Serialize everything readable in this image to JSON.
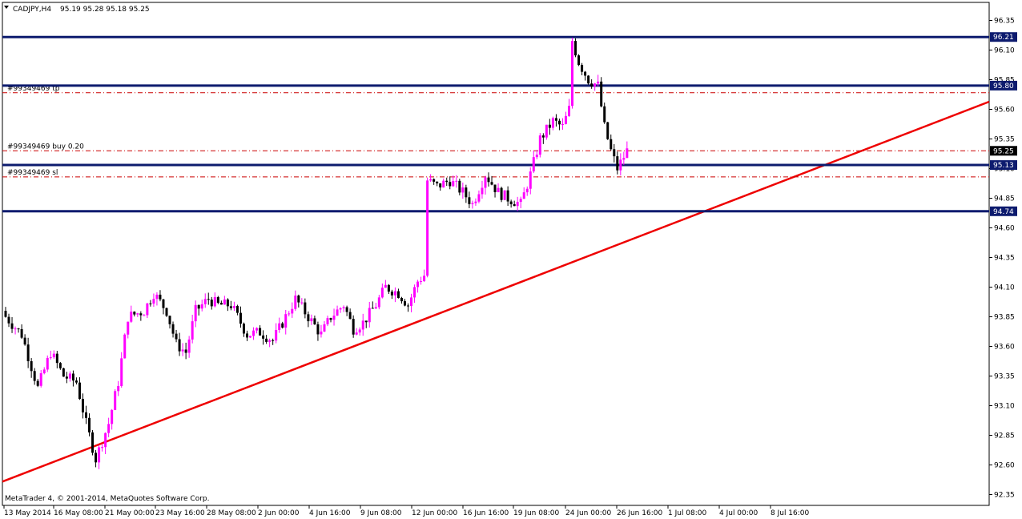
{
  "header": {
    "symbol_timeframe": "CADJPY,H4",
    "ohlc": "95.19 95.28 95.18 95.25"
  },
  "copyright": "MetaTrader 4, © 2001-2014, MetaQuotes Software Corp.",
  "colors": {
    "background": "#ffffff",
    "frame": "#000000",
    "bull_candle": "#ff00ff",
    "bear_candle": "#000000",
    "horizontal_level": "#0d1b6e",
    "trendline": "#ee0000",
    "order_line": "#cc0000"
  },
  "icons": {
    "menu_arrow": "triangle-down-icon"
  },
  "chart_data": {
    "type": "candlestick",
    "instrument": "CADJPY",
    "timeframe": "H4",
    "y_range": [
      92.3,
      96.45
    ],
    "y_ticks": [
      "96.35",
      "96.10",
      "95.85",
      "95.60",
      "95.35",
      "95.10",
      "94.85",
      "94.60",
      "94.35",
      "94.10",
      "93.85",
      "93.60",
      "93.35",
      "93.10",
      "92.85",
      "92.60",
      "92.35"
    ],
    "x_ticks": [
      "13 May 2014",
      "16 May 08:00",
      "21 May 00:00",
      "23 May 16:00",
      "28 May 08:00",
      "2 Jun 00:00",
      "4 Jun 16:00",
      "9 Jun 08:00",
      "12 Jun 00:00",
      "16 Jun 16:00",
      "19 Jun 08:00",
      "24 Jun 00:00",
      "26 Jun 16:00",
      "1 Jul 08:00",
      "4 Jul 00:00",
      "8 Jul 16:00"
    ],
    "candle_count": 242,
    "horizontal_levels": [
      {
        "price": 96.21,
        "label": "96.21"
      },
      {
        "price": 95.8,
        "label": "95.80"
      },
      {
        "price": 95.13,
        "label": "95.13"
      },
      {
        "price": 94.74,
        "label": "94.74"
      }
    ],
    "order_lines": [
      {
        "price": 95.74,
        "label": "#99349469 tp"
      },
      {
        "price": 95.25,
        "label": "#99349469 buy 0.20"
      },
      {
        "price": 95.03,
        "label": "#99349469 sl"
      }
    ],
    "current_price": {
      "price": 95.25,
      "label": "95.25"
    },
    "trendline": {
      "start": {
        "bar": 0,
        "price": 92.47
      },
      "end": {
        "bar": 241,
        "price": 94.99
      }
    },
    "anchors": [
      {
        "bar": 0,
        "price": 93.85
      },
      {
        "bar": 5,
        "price": 93.7
      },
      {
        "bar": 10,
        "price": 93.25
      },
      {
        "bar": 14,
        "price": 93.55
      },
      {
        "bar": 18,
        "price": 93.35
      },
      {
        "bar": 22,
        "price": 93.3
      },
      {
        "bar": 25,
        "price": 92.95
      },
      {
        "bar": 28,
        "price": 92.65
      },
      {
        "bar": 32,
        "price": 92.95
      },
      {
        "bar": 35,
        "price": 93.3
      },
      {
        "bar": 38,
        "price": 93.85
      },
      {
        "bar": 43,
        "price": 93.9
      },
      {
        "bar": 46,
        "price": 94.05
      },
      {
        "bar": 50,
        "price": 93.9
      },
      {
        "bar": 53,
        "price": 93.62
      },
      {
        "bar": 56,
        "price": 93.55
      },
      {
        "bar": 59,
        "price": 93.9
      },
      {
        "bar": 63,
        "price": 94.0
      },
      {
        "bar": 66,
        "price": 93.95
      },
      {
        "bar": 70,
        "price": 93.95
      },
      {
        "bar": 75,
        "price": 93.7
      },
      {
        "bar": 79,
        "price": 93.72
      },
      {
        "bar": 83,
        "price": 93.65
      },
      {
        "bar": 86,
        "price": 93.8
      },
      {
        "bar": 90,
        "price": 94.0
      },
      {
        "bar": 94,
        "price": 93.85
      },
      {
        "bar": 98,
        "price": 93.7
      },
      {
        "bar": 101,
        "price": 93.85
      },
      {
        "bar": 105,
        "price": 93.95
      },
      {
        "bar": 108,
        "price": 93.75
      },
      {
        "bar": 111,
        "price": 93.8
      },
      {
        "bar": 115,
        "price": 93.95
      },
      {
        "bar": 118,
        "price": 94.1
      },
      {
        "bar": 122,
        "price": 94.05
      },
      {
        "bar": 125,
        "price": 93.95
      },
      {
        "bar": 128,
        "price": 94.15
      },
      {
        "bar": 130,
        "price": 94.2
      },
      {
        "bar": 131,
        "price": 95.0
      },
      {
        "bar": 134,
        "price": 94.95
      },
      {
        "bar": 138,
        "price": 95.0
      },
      {
        "bar": 142,
        "price": 94.9
      },
      {
        "bar": 145,
        "price": 94.8
      },
      {
        "bar": 149,
        "price": 95.05
      },
      {
        "bar": 153,
        "price": 94.9
      },
      {
        "bar": 156,
        "price": 94.85
      },
      {
        "bar": 160,
        "price": 94.8
      },
      {
        "bar": 163,
        "price": 95.05
      },
      {
        "bar": 166,
        "price": 95.35
      },
      {
        "bar": 170,
        "price": 95.5
      },
      {
        "bar": 173,
        "price": 95.45
      },
      {
        "bar": 175,
        "price": 95.6
      },
      {
        "bar": 176,
        "price": 96.18
      },
      {
        "bar": 178,
        "price": 96.0
      },
      {
        "bar": 181,
        "price": 95.85
      },
      {
        "bar": 184,
        "price": 95.8
      },
      {
        "bar": 186,
        "price": 95.45
      },
      {
        "bar": 188,
        "price": 95.25
      },
      {
        "bar": 190,
        "price": 95.1
      },
      {
        "bar": 193,
        "price": 95.25
      }
    ]
  }
}
